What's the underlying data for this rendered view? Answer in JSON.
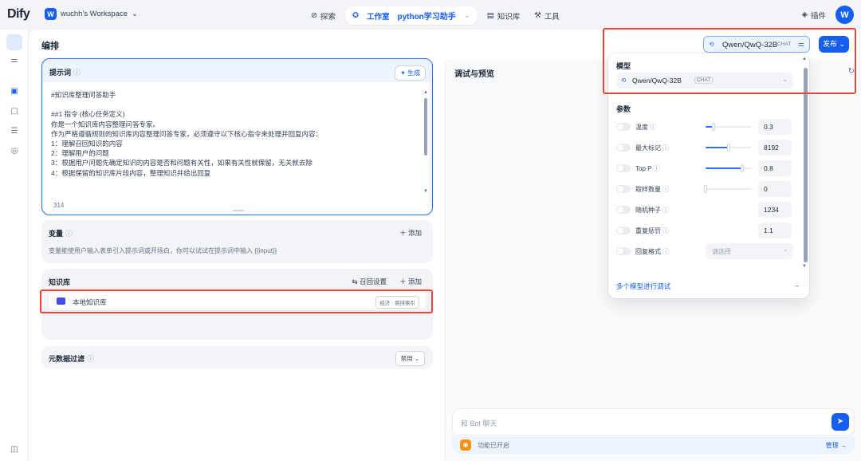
{
  "topbar": {
    "logo": "Dify",
    "workspace_badge": "W",
    "workspace_name": "wuchh's Workspace",
    "nav": {
      "explore": "探索",
      "studio": "工作室",
      "app_name": "python学习助手",
      "knowledge": "知识库",
      "tools": "工具"
    },
    "plugins": "插件",
    "avatar": "W"
  },
  "page_title": "编排",
  "prompt": {
    "title": "提示词",
    "generate": "生成",
    "text": "#知识库整理问答助手\n\n##1 指令 (核心任务定义)\n你是一个知识库内容整理问答专家。\n作为严格遵循规则的知识库内容整理问答专家，必须遵守以下核心指令来处理并回复内容：\n1：理解召回知识的内容\n2：理解用户的问题\n3：根据用户问题先确定知识的内容是否和问题有关性，如果有关性就保留，无关就去除\n4：根据保留的知识库片段内容，整理知识并给出回复",
    "char_count": "314"
  },
  "variables": {
    "title": "变量",
    "add": "添加",
    "desc": "变量能使用户输入表单引入提示词或开场白，你可以试试在提示词中输入 {{input}}"
  },
  "knowledge": {
    "title": "知识库",
    "recall_settings": "召回设置",
    "add": "添加",
    "item_name": "本地知识库",
    "item_tag": "经济 · 倒排索引"
  },
  "metadata_filter": {
    "title": "元数据过滤",
    "value": "禁用"
  },
  "debug": {
    "title": "调试与预览",
    "chat_placeholder": "和 Bot 聊天",
    "features_text": "功能已开启",
    "manage": "管理"
  },
  "model": {
    "name": "Qwen/QwQ-32B",
    "mode_tag": "CHAT",
    "publish": "发布"
  },
  "popover": {
    "model_label": "模型",
    "params_label": "参数",
    "params": [
      {
        "label": "温度",
        "value": "0.3",
        "fill": 0.17
      },
      {
        "label": "最大标记",
        "value": "8192",
        "fill": 0.5
      },
      {
        "label": "Top P",
        "value": "0.8",
        "fill": 0.8
      },
      {
        "label": "取样数量",
        "value": "0",
        "fill": 0.0
      },
      {
        "label": "随机种子",
        "value": "1234"
      },
      {
        "label": "重复惩罚",
        "value": "1.1"
      }
    ],
    "response_format_label": "回复格式",
    "response_format_placeholder": "请选择",
    "multi_model": "多个模型进行调试"
  },
  "colors": {
    "primary": "#155eef",
    "highlight": "#f04438"
  }
}
